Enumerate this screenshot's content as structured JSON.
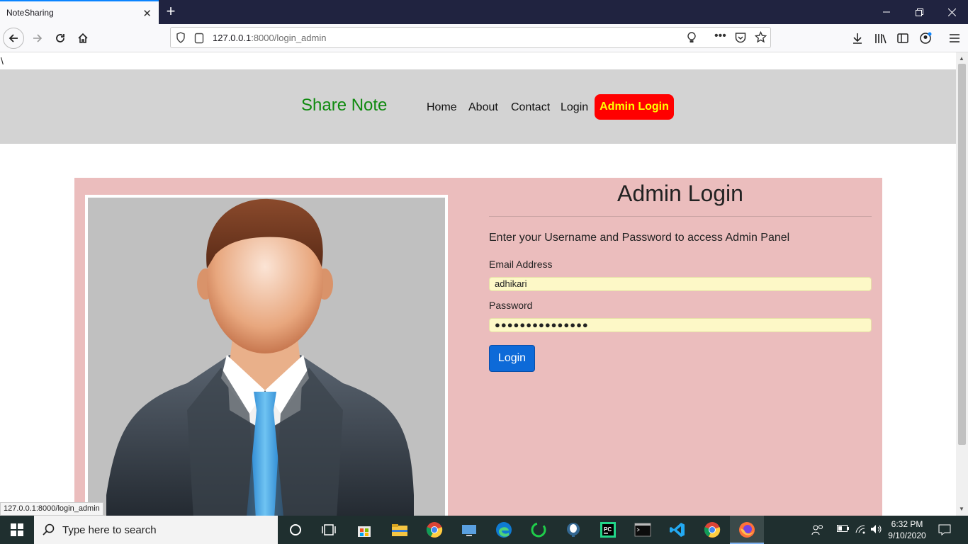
{
  "browser": {
    "tab_title": "NoteSharing",
    "new_tab_label": "+",
    "url_host": "127.0.0.1",
    "url_rest": ":8000/login_admin",
    "status_url": "127.0.0.1:8000/login_admin",
    "stray_text": "\\"
  },
  "site": {
    "brand": "Share Note",
    "nav": {
      "home": "Home",
      "about": "About",
      "contact": "Contact",
      "login": "Login",
      "admin_login": "Admin Login"
    },
    "colors": {
      "header_bg": "#d3d3d3",
      "brand": "#0f8a0f",
      "admin_btn_bg": "#ff0000",
      "admin_btn_text": "#ffff00",
      "panel_bg": "#ebbdbd"
    }
  },
  "form": {
    "title": "Admin Login",
    "intro": "Enter your Username and Password to access Admin Panel",
    "email_label": "Email Address",
    "email_value": "adhikari",
    "password_label": "Password",
    "password_value": "●●●●●●●●●●●●●●●",
    "submit_label": "Login"
  },
  "taskbar": {
    "search_placeholder": "Type here to search",
    "time": "6:32 PM",
    "date": "9/10/2020"
  }
}
